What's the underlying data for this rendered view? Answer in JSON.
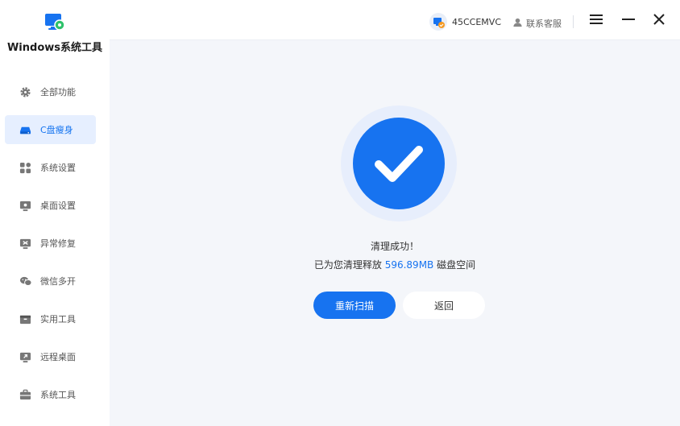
{
  "app": {
    "title": "Windows系统工具"
  },
  "sidebar": {
    "items": [
      {
        "label": "全部功能",
        "icon": "gear-icon",
        "active": false
      },
      {
        "label": "C盘瘦身",
        "icon": "disk-icon",
        "active": true
      },
      {
        "label": "系统设置",
        "icon": "grid-icon",
        "active": false
      },
      {
        "label": "桌面设置",
        "icon": "monitor-icon",
        "active": false
      },
      {
        "label": "异常修复",
        "icon": "repair-icon",
        "active": false
      },
      {
        "label": "微信多开",
        "icon": "wechat-icon",
        "active": false
      },
      {
        "label": "实用工具",
        "icon": "toolbox-icon",
        "active": false
      },
      {
        "label": "远程桌面",
        "icon": "remote-icon",
        "active": false
      },
      {
        "label": "系统工具",
        "icon": "briefcase-icon",
        "active": false
      }
    ]
  },
  "header": {
    "user_name": "45CCEMVC",
    "support_label": "联系客服"
  },
  "result": {
    "title": "清理成功！",
    "prefix": "已为您清理释放",
    "amount": "596.89MB",
    "suffix": "磁盘空间"
  },
  "actions": {
    "rescan_label": "重新扫描",
    "back_label": "返回"
  },
  "colors": {
    "accent": "#1773f0",
    "active_bg": "#e6efff",
    "ring": "#e7eefc"
  }
}
